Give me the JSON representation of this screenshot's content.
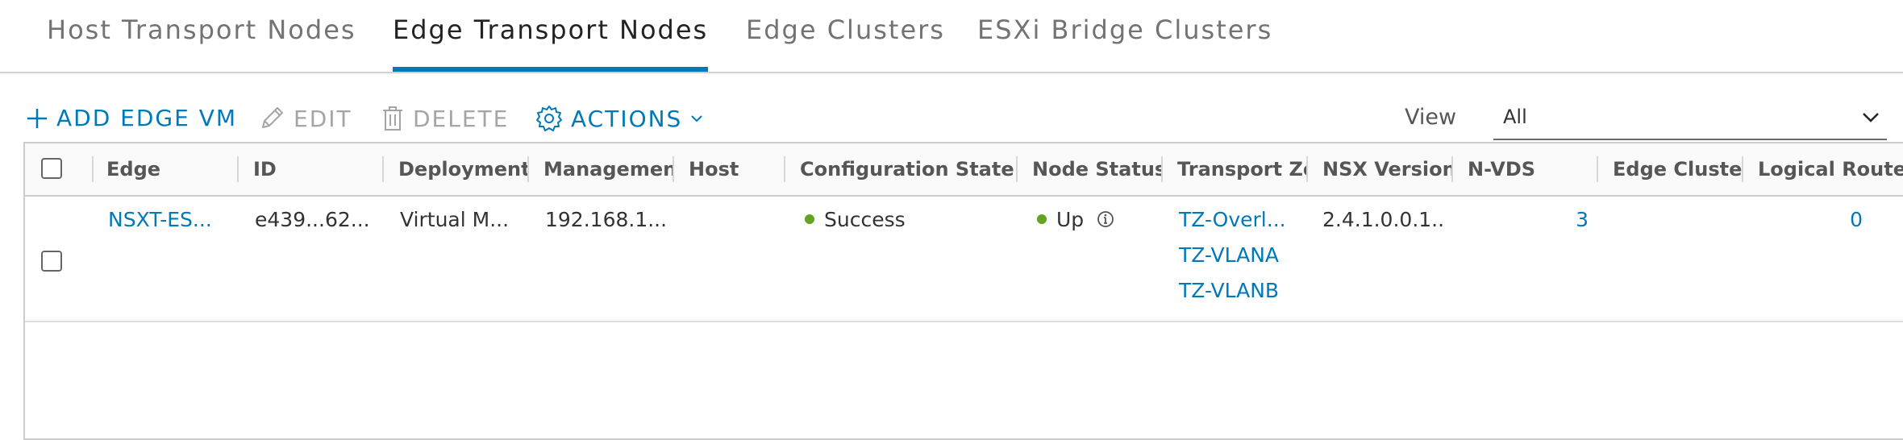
{
  "tabs": [
    {
      "label": "Host Transport Nodes"
    },
    {
      "label": "Edge Transport Nodes",
      "active": true
    },
    {
      "label": "Edge Clusters"
    },
    {
      "label": "ESXi Bridge Clusters"
    }
  ],
  "toolbar": {
    "add_label": "ADD EDGE VM",
    "edit_label": "EDIT",
    "delete_label": "DELETE",
    "actions_label": "ACTIONS",
    "view_label": "View",
    "view_value": "All"
  },
  "table": {
    "columns": {
      "edge": "Edge",
      "id": "ID",
      "deployment": "Deployment T",
      "management": "Management",
      "host": "Host",
      "config_state": "Configuration State",
      "node_status": "Node Status",
      "transport_zones": "Transport Zo",
      "nsx_version": "NSX Version",
      "nvds": "N-VDS",
      "edge_cluster": "Edge Cluster",
      "logical_routers": "Logical Route"
    },
    "rows": [
      {
        "edge": "NSXT-ES...",
        "id": "e439...62...",
        "deployment": "Virtual M...",
        "management": "192.168.1...",
        "host": "",
        "config_state": "Success",
        "node_status": "Up",
        "transport_zones": [
          "TZ-Overl...",
          "TZ-VLANA",
          "TZ-VLANB"
        ],
        "nsx_version": "2.4.1.0.0.1...",
        "nvds": "3",
        "edge_cluster": "",
        "logical_routers": "0"
      }
    ]
  },
  "colors": {
    "accent": "#0079b8",
    "success": "#62a420"
  }
}
